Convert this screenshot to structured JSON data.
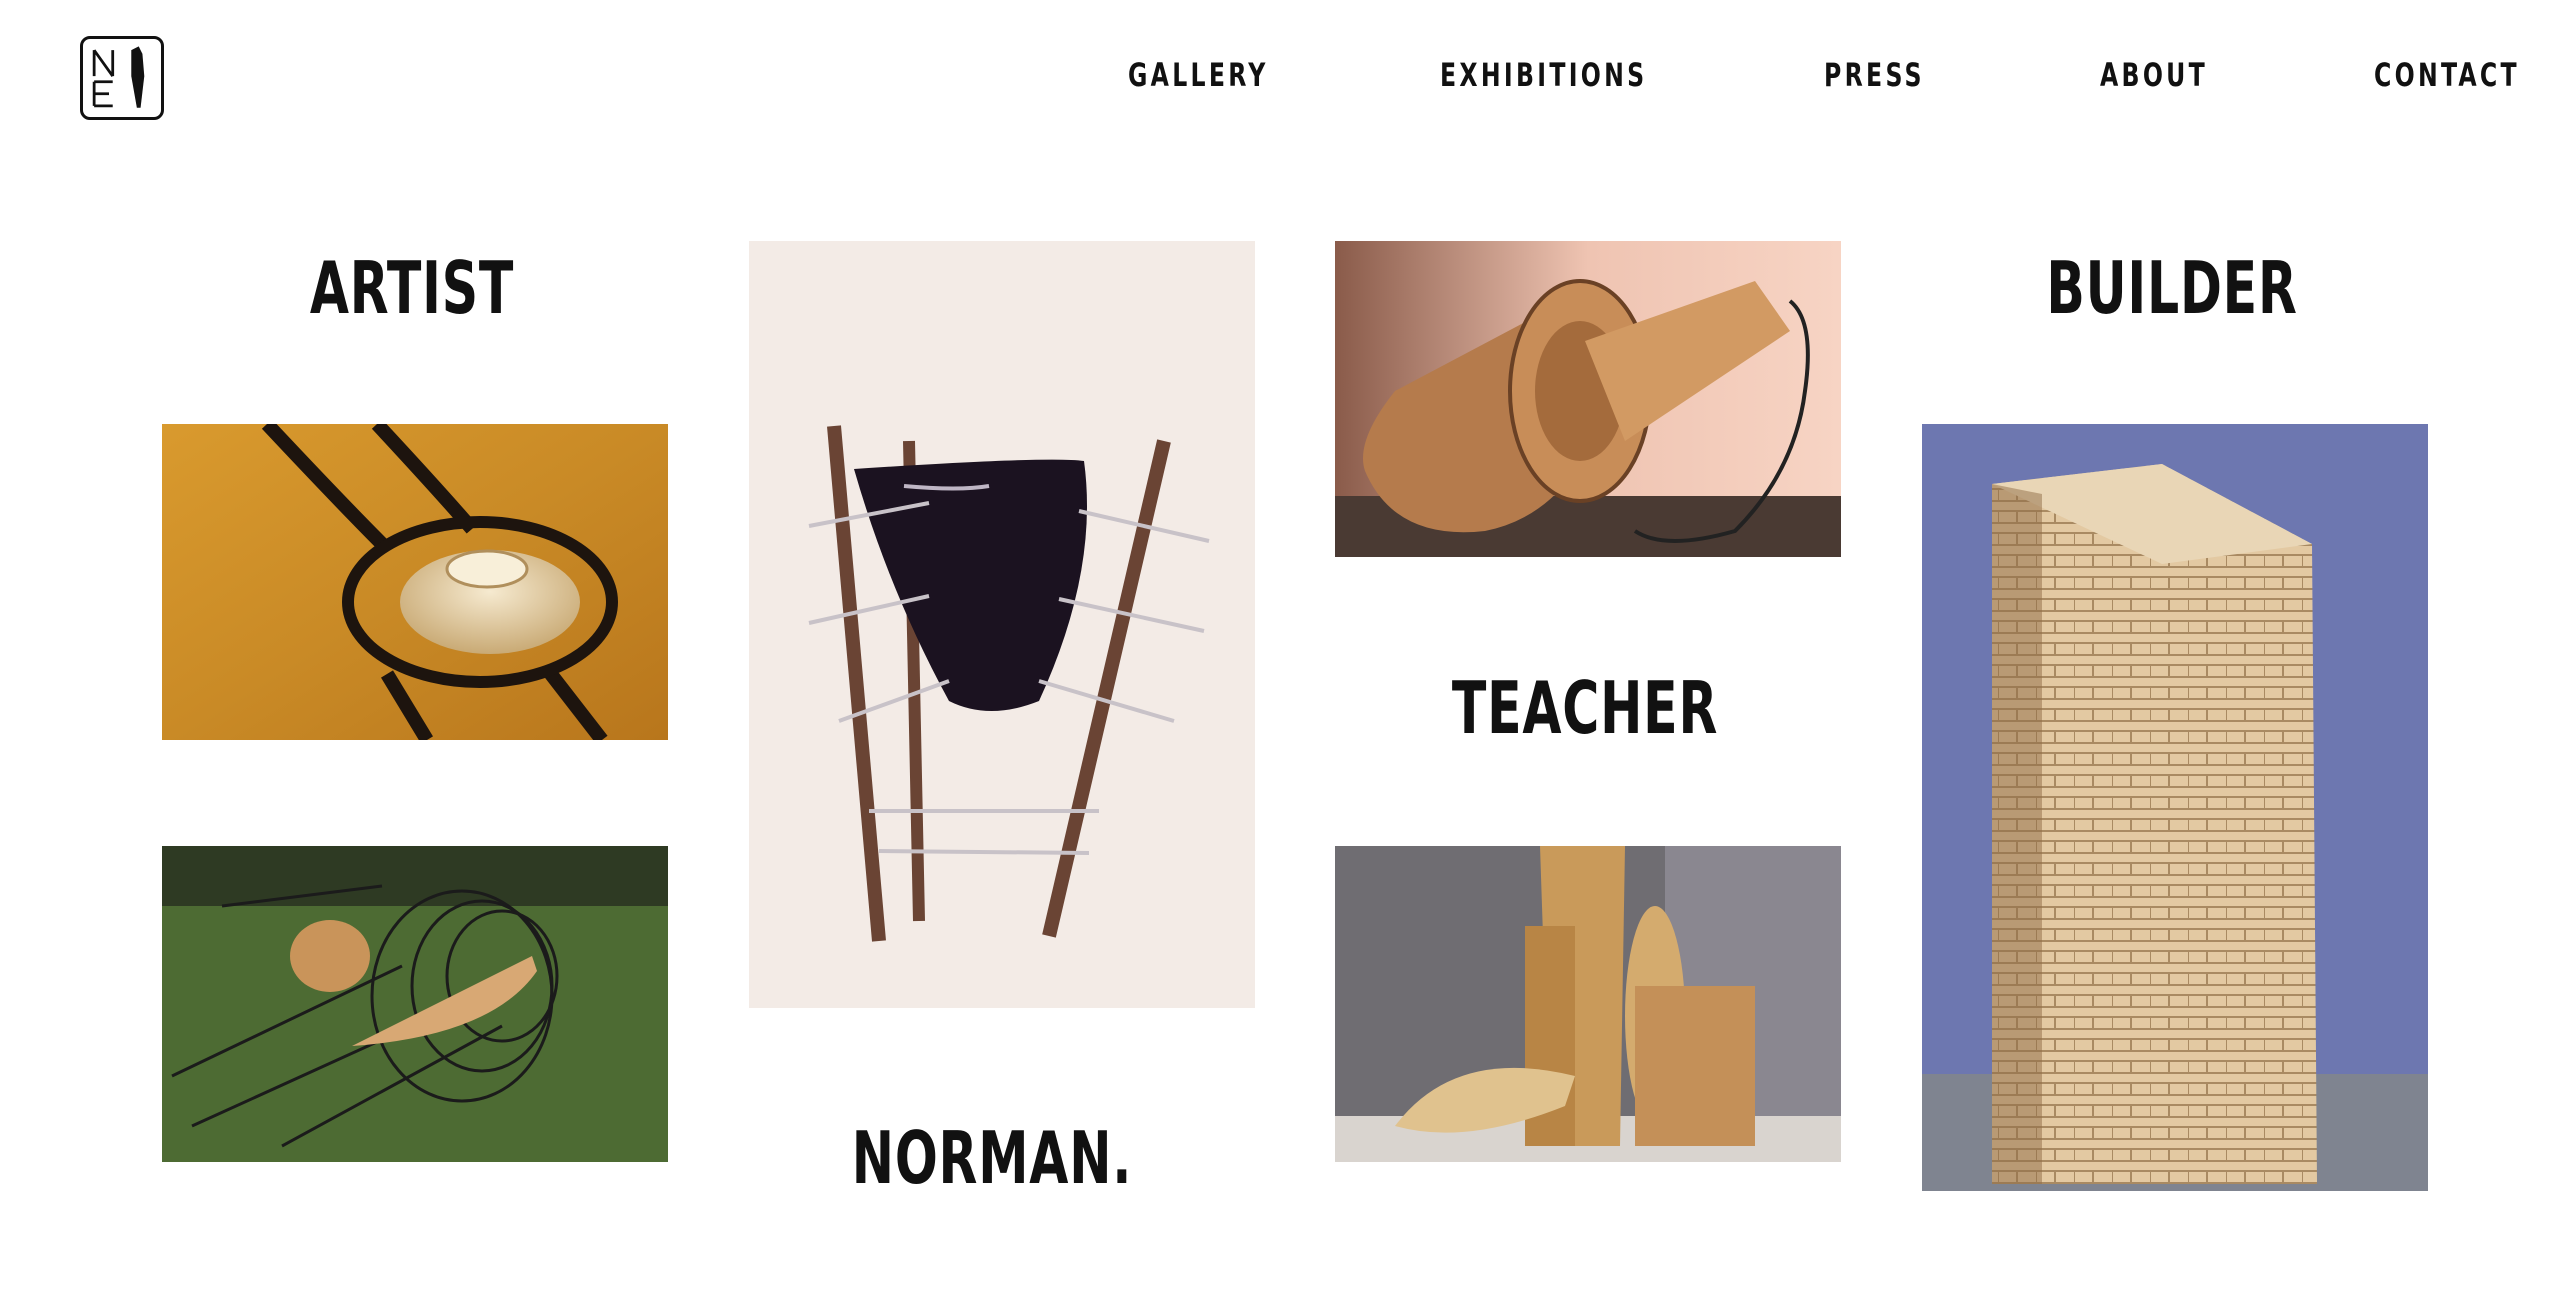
{
  "nav": {
    "items": [
      {
        "label": "GALLERY"
      },
      {
        "label": "EXHIBITIONS"
      },
      {
        "label": "PRESS"
      },
      {
        "label": "ABOUT"
      },
      {
        "label": "CONTACT"
      }
    ]
  },
  "headings": {
    "artist": "ARTIST",
    "builder": "BUILDER",
    "teacher": "TEACHER",
    "norman": "NORMAN."
  },
  "logo": {
    "icon": "ne-monogram-logo",
    "letters": "NE"
  },
  "tiles": [
    {
      "icon": "sculpture-orange-disk-image",
      "accent": "#c98a26"
    },
    {
      "icon": "sculpture-black-vessel-image",
      "accent": "#1a1020"
    },
    {
      "icon": "sculpture-wood-cone-image",
      "accent": "#b07a4e"
    },
    {
      "icon": "sculpture-wire-grass-image",
      "accent": "#4d6b33"
    },
    {
      "icon": "sculpture-wood-structure-image",
      "accent": "#c89a58"
    },
    {
      "icon": "sculpture-brick-tower-image",
      "accent": "#6d77b0"
    }
  ]
}
